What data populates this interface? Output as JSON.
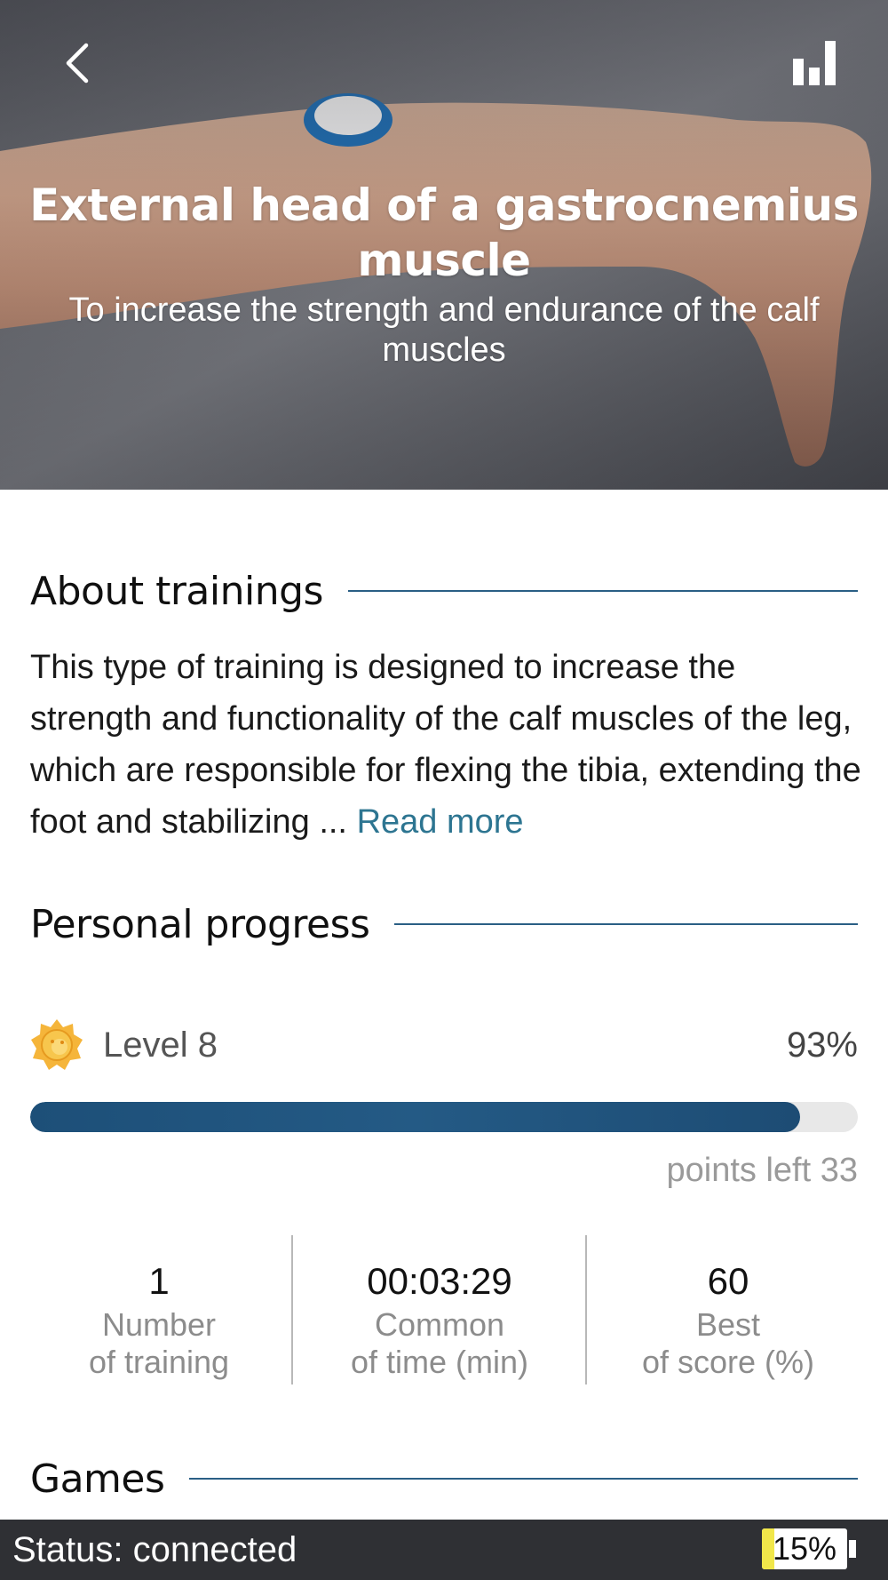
{
  "hero": {
    "title": "External head of a gastrocnemius muscle",
    "subtitle": "To increase the strength and endurance of the calf muscles",
    "back_icon": "chevron-left-icon",
    "stats_icon": "bar-chart-icon"
  },
  "about": {
    "heading": "About trainings",
    "text": "This type of training is designed to increase the strength and functionality of the calf muscles of the leg, which are responsible for flexing the tibia, extending the foot and stabilizing ...",
    "read_more": "Read more"
  },
  "progress": {
    "heading": "Personal progress",
    "level_icon": "sun-medal-icon",
    "level_label": "Level 8",
    "percent_label": "93%",
    "percent_value": 0.93,
    "points_left": "points left 33"
  },
  "stats": [
    {
      "value": "1",
      "label_line1": "Number",
      "label_line2": "of training"
    },
    {
      "value": "00:03:29",
      "label_line1": "Common",
      "label_line2": "of time (min)"
    },
    {
      "value": "60",
      "label_line1": "Best",
      "label_line2": "of score (%)"
    }
  ],
  "games": {
    "heading": "Games"
  },
  "status_bar": {
    "status": "Status: connected",
    "battery_label": "15%",
    "battery_level": 0.15
  },
  "colors": {
    "accent": "#2a5f85",
    "link": "#2d7591",
    "progress_fill": "#1d4f78",
    "status_bar": "#2f3034",
    "battery_fill": "#f1e74a"
  }
}
